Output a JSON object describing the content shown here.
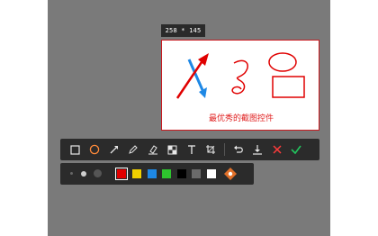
{
  "size_label": "258 * 145",
  "caption": "最优秀的截图控件",
  "toolbar": {
    "tools": [
      "rectangle-tool",
      "ellipse-tool",
      "arrow-tool",
      "pen-tool",
      "highlighter-tool",
      "mosaic-tool",
      "text-tool",
      "crop-tool",
      "undo-tool",
      "save-tool",
      "cancel-tool",
      "confirm-tool"
    ]
  },
  "palette": {
    "brush_sizes": [
      "small",
      "medium",
      "large"
    ],
    "selected_color": "#e00000",
    "colors": [
      "#e00000",
      "#f0d000",
      "#1e88e5",
      "#2ec42e",
      "#000000",
      "#6b6b6b",
      "#ffffff"
    ]
  },
  "colors": {
    "accent_red": "#e02020",
    "confirm_green": "#22c55e",
    "toolbar_bg": "#2b2b2b"
  }
}
